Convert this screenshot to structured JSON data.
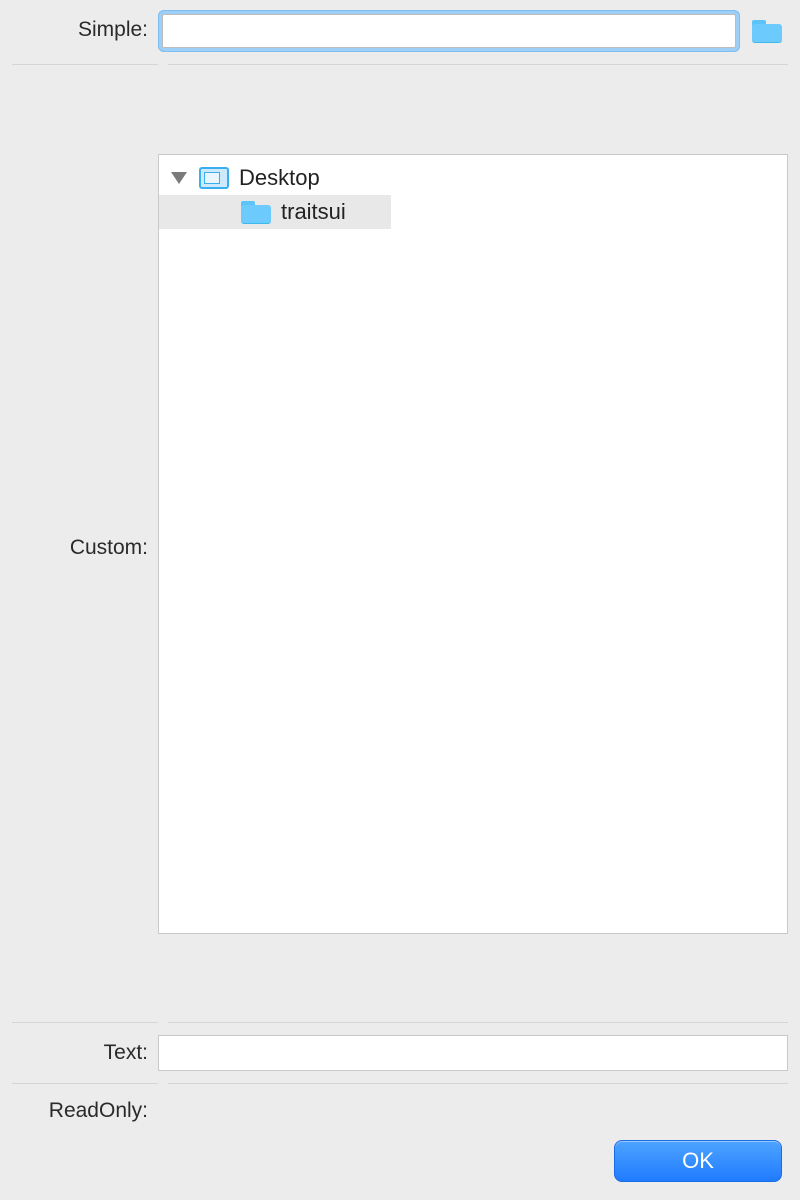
{
  "labels": {
    "simple": "Simple:",
    "custom": "Custom:",
    "text": "Text:",
    "readonly": "ReadOnly:"
  },
  "simple": {
    "value": "",
    "placeholder": ""
  },
  "tree": {
    "root": {
      "label": "Desktop",
      "expanded": true
    },
    "children": [
      {
        "label": "traitsui",
        "selected": true
      }
    ]
  },
  "text": {
    "value": ""
  },
  "readonly": {
    "value": ""
  },
  "buttons": {
    "ok": "OK"
  }
}
